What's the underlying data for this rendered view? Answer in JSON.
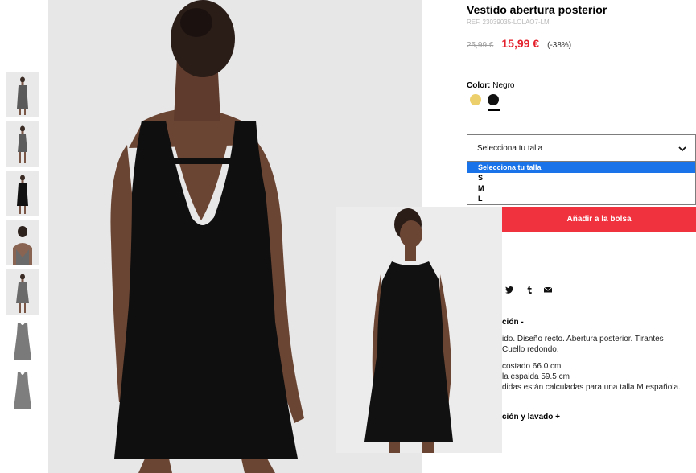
{
  "product": {
    "title": "Vestido abertura posterior",
    "ref": "REF. 23039035-LOLAO7-LM",
    "old_price": "25,99 €",
    "new_price": "15,99 €",
    "discount": "(-38%)"
  },
  "color": {
    "label": "Color:",
    "value": "Negro",
    "swatches": [
      {
        "name": "Amarillo",
        "hex": "#ecce6a"
      },
      {
        "name": "Negro",
        "hex": "#111111",
        "selected": true
      }
    ]
  },
  "size_select": {
    "value": "Selecciona tu talla",
    "options": [
      "Selecciona tu talla",
      "S",
      "M",
      "L"
    ],
    "selected_index": 0
  },
  "add_to_bag": "Añadir a la bolsa",
  "share_icons": [
    "twitter-icon",
    "tumblr-icon",
    "mail-icon"
  ],
  "description": {
    "heading": "ción -",
    "line1": "ido. Diseño recto. Abertura posterior. Tirantes",
    "line2": "Cuello redondo.",
    "measure1": "costado 66.0 cm",
    "measure2": "la espalda 59.5 cm",
    "measure3": "didas están calculadas para una talla M española.",
    "care": "ción y lavado +"
  },
  "colors": {
    "accent": "#f0323f",
    "price": "#e4202c",
    "select_highlight": "#1a73e8"
  }
}
